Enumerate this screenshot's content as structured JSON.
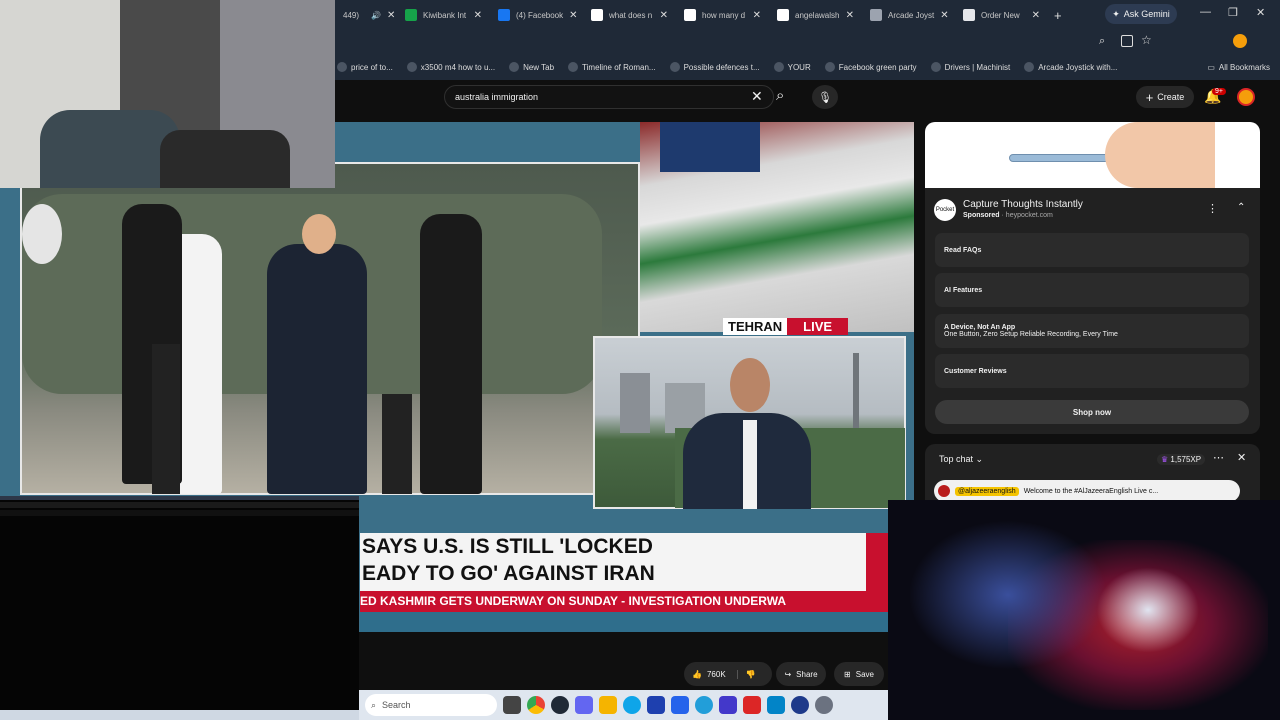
{
  "browser": {
    "tabs": [
      {
        "label": "Kiwibank Int",
        "icon_color": "#16a34a"
      },
      {
        "label": "(4) Facebook",
        "icon_color": "#1877f2"
      },
      {
        "label": "what does n",
        "icon_color": "#ffffff"
      },
      {
        "label": "how many d",
        "icon_color": "#ffffff"
      },
      {
        "label": "angelawalsh",
        "icon_color": "#ffffff"
      },
      {
        "label": "Arcade Joyst",
        "icon_color": "#9ca3af"
      },
      {
        "label": "Order New",
        "icon_color": "#e5e7eb"
      }
    ],
    "partial_tab_text": "449)",
    "new_tab": "+",
    "gemini_label": "Ask Gemini",
    "window_controls": {
      "minimize": "—",
      "maximize": "❐",
      "close": "✕"
    },
    "bookmarks": [
      {
        "label": "price of to..."
      },
      {
        "label": "x3500 m4 how to u..."
      },
      {
        "label": "New Tab"
      },
      {
        "label": "Timeline of Roman..."
      },
      {
        "label": "Possible defences t..."
      },
      {
        "label": "YOUR"
      },
      {
        "label": "Facebook green party"
      },
      {
        "label": "Drivers | Machinist"
      },
      {
        "label": "Arcade Joystick with..."
      }
    ],
    "all_bookmarks": "All Bookmarks"
  },
  "youtube": {
    "search_value": "australia immigration",
    "create_label": "Create",
    "notification_count": "9+"
  },
  "video": {
    "location_label": "TEHRAN",
    "live_label": "LIVE",
    "caption_line1": "SAYS U.S. IS STILL 'LOCKED",
    "caption_line2": "EADY TO GO' AGAINST IRAN",
    "ticker": "ED KASHMIR GETS UNDERWAY ON SUNDAY   -   INVESTIGATION UNDERWA"
  },
  "actions": {
    "likes": "760K",
    "share": "Share",
    "save": "Save"
  },
  "ad": {
    "title": "Capture Thoughts Instantly",
    "sponsored": "Sponsored",
    "domain": "heypocket.com",
    "logo_text": "Pocket",
    "items": [
      {
        "title": "Read FAQs",
        "sub": ""
      },
      {
        "title": "AI Features",
        "sub": ""
      },
      {
        "title": "A Device, Not An App",
        "sub": "One Button, Zero Setup Reliable Recording, Every Time"
      },
      {
        "title": "Customer Reviews",
        "sub": ""
      }
    ],
    "shop_now": "Shop now"
  },
  "chat": {
    "title": "Top chat",
    "xp": "1,575XP",
    "author": "@aljazeeraenglish",
    "message": "Welcome to the #AlJazeeraEnglish Live c..."
  },
  "taskbar": {
    "search_placeholder": "Search"
  }
}
